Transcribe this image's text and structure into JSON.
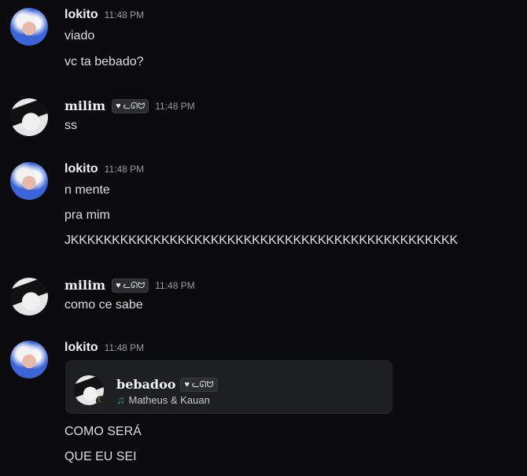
{
  "messages": [
    {
      "user": "lokito",
      "time": "11:48 PM",
      "lines": [
        "viado",
        "vc ta bebado?"
      ]
    },
    {
      "user": "milim",
      "tag": "ᓚᘏᗢ",
      "time": "11:48 PM",
      "lines": [
        "ss"
      ]
    },
    {
      "user": "lokito",
      "time": "11:48 PM",
      "lines": [
        "n mente",
        "pra mim",
        "JKKKKKKKKKKKKKKKKKKKKKKKKKKKKKKKKKKKKKKKKKKKKKKK"
      ]
    },
    {
      "user": "milim",
      "tag": "ᓚᘏᗢ",
      "time": "11:48 PM",
      "lines": [
        "como ce sabe"
      ]
    },
    {
      "user": "lokito",
      "time": "11:48 PM",
      "embed": {
        "name": "bebadoo",
        "tag": "ᓚᘏᗢ",
        "activity": "Matheus & Kauan"
      },
      "lines": [
        "COMO SERÁ",
        "QUE EU SEI"
      ]
    }
  ]
}
